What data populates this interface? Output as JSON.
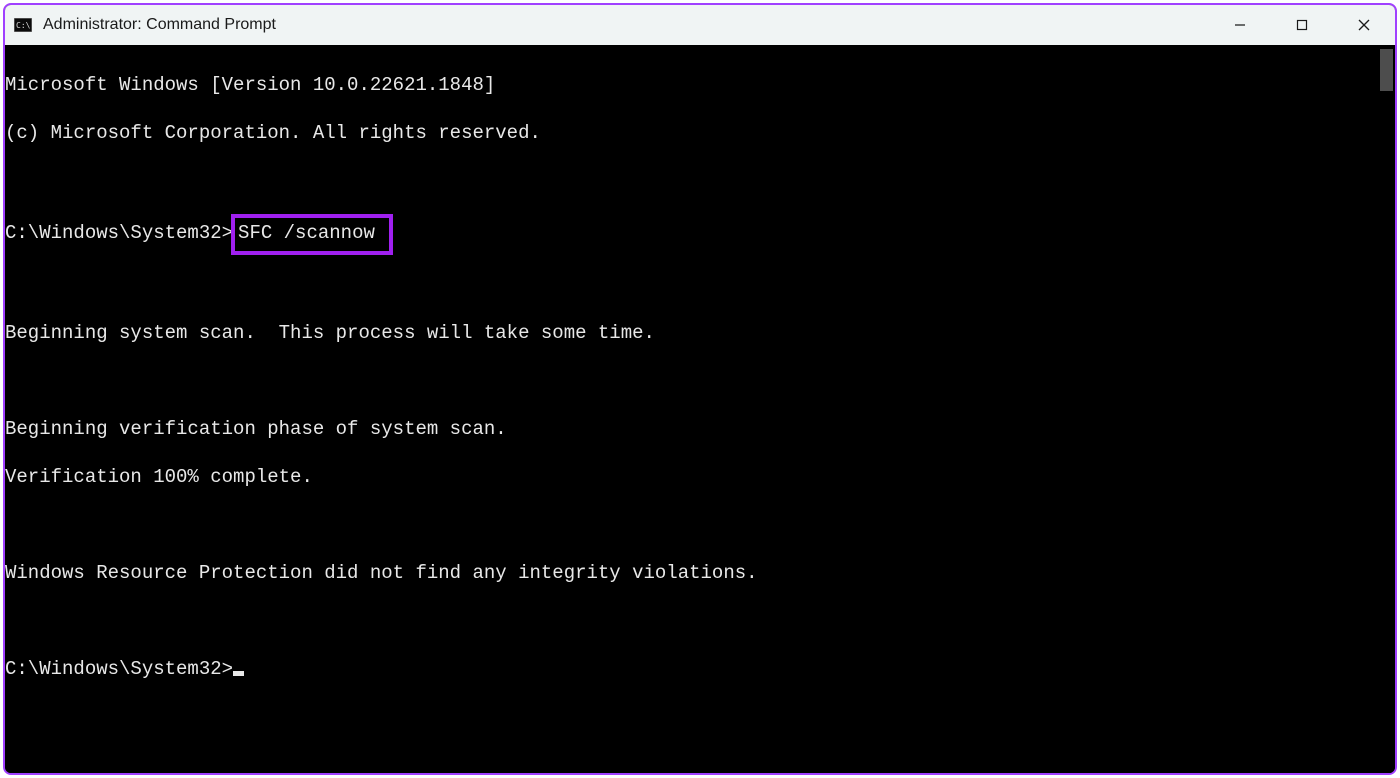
{
  "window": {
    "title": "Administrator: Command Prompt"
  },
  "terminal": {
    "line_version": "Microsoft Windows [Version 10.0.22621.1848]",
    "line_copyright": "(c) Microsoft Corporation. All rights reserved.",
    "prompt1_path": "C:\\Windows\\System32>",
    "prompt1_cmd": "SFC /scannow",
    "scan_begin": "Beginning system scan.  This process will take some time.",
    "verify_begin": "Beginning verification phase of system scan.",
    "verify_done": "Verification 100% complete.",
    "wr_result": "Windows Resource Protection did not find any integrity violations.",
    "prompt2_path": "C:\\Windows\\System32>"
  },
  "colors": {
    "highlight_border": "#a020f0",
    "window_border": "#a040ff",
    "terminal_fg": "#e8e8e8",
    "terminal_bg": "#000000",
    "titlebar_bg": "#f0f4f4"
  }
}
